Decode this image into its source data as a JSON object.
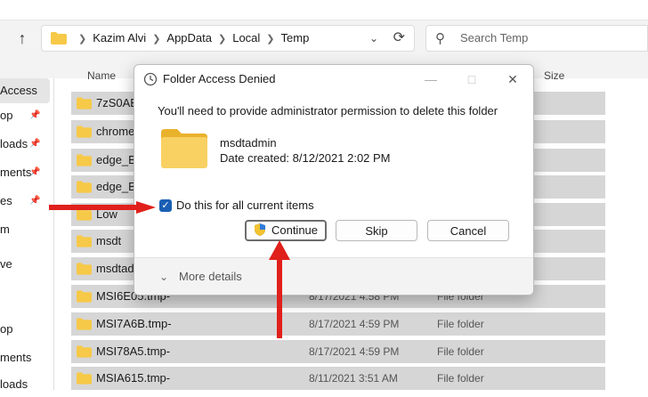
{
  "addressbar": {
    "crumbs": [
      "Kazim Alvi",
      "AppData",
      "Local",
      "Temp"
    ]
  },
  "search": {
    "placeholder": "Search Temp"
  },
  "sidebar": {
    "items": [
      {
        "label": "Access",
        "selected": true,
        "pinned": false
      },
      {
        "label": "op",
        "selected": false,
        "pinned": true
      },
      {
        "label": "loads",
        "selected": false,
        "pinned": true
      },
      {
        "label": "ments",
        "selected": false,
        "pinned": true
      },
      {
        "label": "es",
        "selected": false,
        "pinned": true
      },
      {
        "label": "m",
        "selected": false,
        "pinned": false
      },
      {
        "label": "ve",
        "selected": false,
        "pinned": false
      },
      {
        "label": "op",
        "selected": false,
        "pinned": false
      },
      {
        "label": "ments",
        "selected": false,
        "pinned": false
      },
      {
        "label": "loads",
        "selected": false,
        "pinned": false
      }
    ]
  },
  "list": {
    "headers": {
      "name": "Name",
      "size": "Size"
    },
    "rows": [
      {
        "name": "7zS0AE2",
        "date": "",
        "type": ""
      },
      {
        "name": "chrome_",
        "date": "",
        "type": ""
      },
      {
        "name": "edge_BIT",
        "date": "",
        "type": ""
      },
      {
        "name": "edge_BIT",
        "date": "",
        "type": ""
      },
      {
        "name": "Low",
        "date": "",
        "type": ""
      },
      {
        "name": "msdt",
        "date": "",
        "type": ""
      },
      {
        "name": "msdtadmi",
        "date": "",
        "type": ""
      },
      {
        "name": "MSI6E05.tmp-",
        "date": "8/17/2021 4:58 PM",
        "type": "File folder"
      },
      {
        "name": "MSI7A6B.tmp-",
        "date": "8/17/2021 4:59 PM",
        "type": "File folder"
      },
      {
        "name": "MSI78A5.tmp-",
        "date": "8/17/2021 4:59 PM",
        "type": "File folder"
      },
      {
        "name": "MSIA615.tmp-",
        "date": "8/11/2021 3:51 AM",
        "type": "File folder"
      }
    ]
  },
  "dialog": {
    "title": "Folder Access Denied",
    "message": "You'll need to provide administrator permission to delete this folder",
    "item_name": "msdtadmin",
    "item_date": "Date created: 8/12/2021 2:02 PM",
    "checkbox_label": "Do this for all current items",
    "checkbox_checked": true,
    "continue_label": "Continue",
    "skip_label": "Skip",
    "cancel_label": "Cancel",
    "more_details": "More details"
  },
  "colors": {
    "accent": "#1a5fb4",
    "folder": "#f7c948",
    "annotation": "#e0201b",
    "row_selected": "#d6d6d6"
  }
}
